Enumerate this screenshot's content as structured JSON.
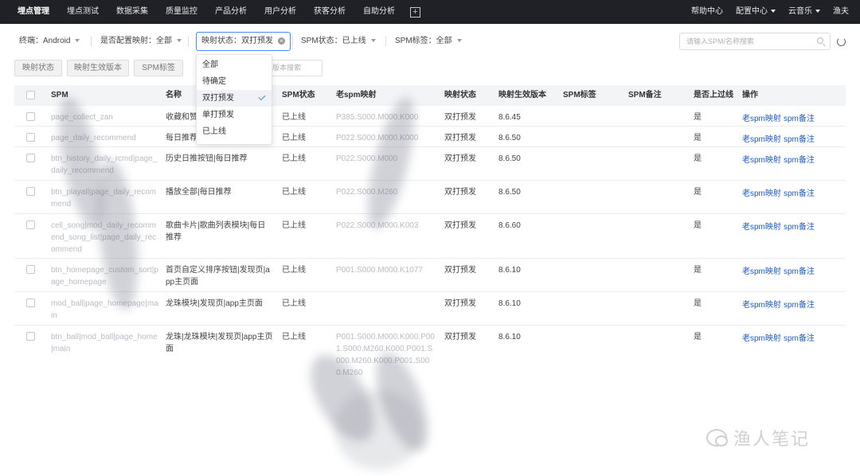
{
  "topnav": {
    "items": [
      "埋点管理",
      "埋点测试",
      "数据采集",
      "质量监控",
      "产品分析",
      "用户分析",
      "获客分析",
      "自助分析"
    ],
    "plus": "+",
    "right": [
      "帮助中心",
      "配置中心",
      "云音乐",
      "渔夫"
    ]
  },
  "filters": {
    "platform": "终端：Android",
    "has_mapping": "是否配置映射：全部",
    "mapping_status": "映射状态：双打预发",
    "spm_status": "SPM状态：已上线",
    "spm_tag": "SPM标签：全部",
    "search_placeholder": "请输入SPM/名称搜索"
  },
  "tabs": [
    "映射状态",
    "映射生效版本",
    "SPM标签"
  ],
  "version_search_placeholder": "版本搜索",
  "dropdown": {
    "options": [
      "全部",
      "待确定",
      "双打预发",
      "单打预发",
      "已上线"
    ],
    "selected_index": 2
  },
  "table": {
    "headers": [
      "SPM",
      "名称",
      "SPM状态",
      "老spm映射",
      "映射状态",
      "映射生效版本",
      "SPM标签",
      "SPM备注",
      "是否上过线",
      "操作"
    ],
    "rows": [
      {
        "spm": "page_collect_zan",
        "name": "收藏和赞",
        "status": "已上线",
        "old": "P385.S000.M000.K000",
        "map_status": "双打预发",
        "version": "8.6.45",
        "online": "是"
      },
      {
        "spm": "page_daily_recommend",
        "name": "每日推荐",
        "status": "已上线",
        "old": "P022.S000.M000.K000",
        "map_status": "双打预发",
        "version": "8.6.50",
        "online": "是"
      },
      {
        "spm": "btn_history_daily_rcmd|page_daily_recommend",
        "name": "历史日推按钮|每日推荐",
        "status": "已上线",
        "old": "P022.S000.M000",
        "map_status": "双打预发",
        "version": "8.6.50",
        "online": "是"
      },
      {
        "spm": "btn_playall|page_daily_recommend",
        "name": "播放全部|每日推荐",
        "status": "已上线",
        "old": "P022.S000.M260",
        "map_status": "双打预发",
        "version": "8.6.50",
        "online": "是"
      },
      {
        "spm": "cell_song|mod_daily_recommend_song_list|page_daily_recommend",
        "name": "歌曲卡片|歌曲列表模块|每日推荐",
        "status": "已上线",
        "old": "P022.S000.M000.K003",
        "map_status": "双打预发",
        "version": "8.6.60",
        "online": "是"
      },
      {
        "spm": "btn_homepage_custom_sort|page_homepage",
        "name": "首页自定义排序按钮|发现页|app主页面",
        "status": "已上线",
        "old": "P001.S000.M000.K1077",
        "map_status": "双打预发",
        "version": "8.6.10",
        "online": "是"
      },
      {
        "spm": "mod_ball|page_homepage|main",
        "name": "龙珠模块|发现页|app主页面",
        "status": "已上线",
        "old": "",
        "map_status": "双打预发",
        "version": "8.6.10",
        "online": "是"
      },
      {
        "spm": "btn_ball|mod_ball|page_home|main",
        "name": "龙珠|龙珠模块|发现页|app主页面",
        "status": "已上线",
        "old": "P001.S000.M000.K000.P001.S000.M260.K000.P001.S000.M260.K000.P001.S000.M260",
        "map_status": "双打预发",
        "version": "8.6.10",
        "online": "是"
      }
    ],
    "actions": [
      "老spm映射",
      "spm备注"
    ]
  },
  "watermark": "渔人笔记",
  "colors": {
    "nav_bg": "#1f2126",
    "link": "#1d5bbf",
    "accent": "#4b87ff"
  }
}
